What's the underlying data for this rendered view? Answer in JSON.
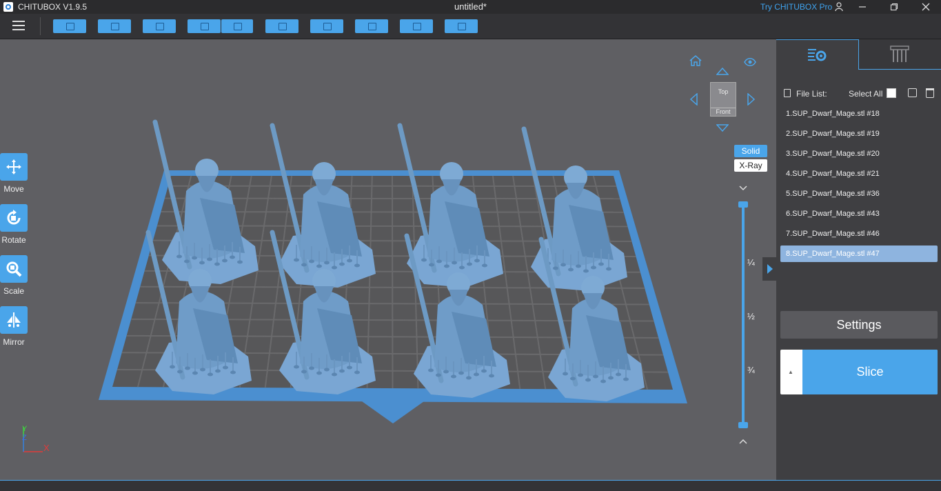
{
  "titlebar": {
    "app_name": "CHITUBOX V1.9.5",
    "doc_title": "untitled*",
    "pro_link": "Try CHITUBOX Pro",
    "icons": [
      "user-icon",
      "minimize-icon",
      "restore-icon",
      "close-icon"
    ]
  },
  "toolbar": {
    "buttons": [
      "open-file",
      "save",
      "import-project",
      "undo",
      "redo",
      "copy",
      "arrange",
      "auto-support",
      "hollow",
      "dig-hole"
    ]
  },
  "left_tools": [
    {
      "label": "Move",
      "icon": "move-icon"
    },
    {
      "label": "Rotate",
      "icon": "rotate-icon"
    },
    {
      "label": "Scale",
      "icon": "scale-icon"
    },
    {
      "label": "Mirror",
      "icon": "mirror-icon"
    }
  ],
  "viewcube": {
    "top_label": "Top",
    "front_label": "Front"
  },
  "view_modes": {
    "solid": "Solid",
    "xray": "X-Ray"
  },
  "slider": {
    "marks": [
      "¼",
      "½",
      "¾"
    ]
  },
  "axis": {
    "x": "X",
    "y": "Y",
    "z": "Z"
  },
  "right_panel": {
    "file_list_label": "File List:",
    "select_all_label": "Select All",
    "files": [
      "1.SUP_Dwarf_Mage.stl #18",
      "2.SUP_Dwarf_Mage.stl #19",
      "3.SUP_Dwarf_Mage.stl #20",
      "4.SUP_Dwarf_Mage.stl #21",
      "5.SUP_Dwarf_Mage.stl #36",
      "6.SUP_Dwarf_Mage.stl #43",
      "7.SUP_Dwarf_Mage.stl #46",
      "8.SUP_Dwarf_Mage.stl #47"
    ],
    "selected_index": 7,
    "settings_label": "Settings",
    "slice_label": "Slice"
  },
  "colors": {
    "accent": "#4aa5ea",
    "model": "#7aa6cf",
    "plate": "#5a5a5e"
  }
}
